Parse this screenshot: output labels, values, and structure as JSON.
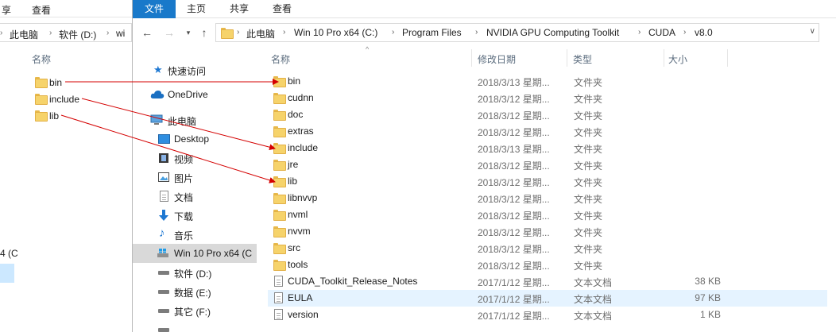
{
  "back_window": {
    "ribbon": {
      "tab1": "享",
      "tab2": "查看"
    },
    "breadcrumb": {
      "c1": "此电脑",
      "c2": "软件 (D:)",
      "c3": "wi"
    },
    "column_name": "名称",
    "items": [
      {
        "name": "bin"
      },
      {
        "name": "include"
      },
      {
        "name": "lib"
      }
    ],
    "side_label": "4 (C"
  },
  "ribbon": {
    "file": "文件",
    "home": "主页",
    "share": "共享",
    "view": "查看"
  },
  "address": {
    "crumbs": [
      "此电脑",
      "Win 10 Pro x64 (C:)",
      "Program Files",
      "NVIDIA GPU Computing Toolkit",
      "CUDA",
      "v8.0"
    ]
  },
  "nav": {
    "quick_access": "快速访问",
    "onedrive": "OneDrive",
    "this_pc": "此电脑",
    "desktop": "Desktop",
    "videos": "视频",
    "pictures": "图片",
    "documents": "文档",
    "downloads": "下载",
    "music": "音乐",
    "drive_c": "Win 10 Pro x64 (C",
    "drive_d": "软件 (D:)",
    "drive_e": "数据 (E:)",
    "drive_f": "其它 (F:)"
  },
  "columns": {
    "name": "名称",
    "modified": "修改日期",
    "type": "类型",
    "size": "大小"
  },
  "files": [
    {
      "name": "bin",
      "date": "2018/3/13 星期...",
      "type": "文件夹",
      "size": "",
      "kind": "folder"
    },
    {
      "name": "cudnn",
      "date": "2018/3/12 星期...",
      "type": "文件夹",
      "size": "",
      "kind": "folder"
    },
    {
      "name": "doc",
      "date": "2018/3/12 星期...",
      "type": "文件夹",
      "size": "",
      "kind": "folder"
    },
    {
      "name": "extras",
      "date": "2018/3/12 星期...",
      "type": "文件夹",
      "size": "",
      "kind": "folder"
    },
    {
      "name": "include",
      "date": "2018/3/13 星期...",
      "type": "文件夹",
      "size": "",
      "kind": "folder"
    },
    {
      "name": "jre",
      "date": "2018/3/12 星期...",
      "type": "文件夹",
      "size": "",
      "kind": "folder"
    },
    {
      "name": "lib",
      "date": "2018/3/12 星期...",
      "type": "文件夹",
      "size": "",
      "kind": "folder"
    },
    {
      "name": "libnvvp",
      "date": "2018/3/12 星期...",
      "type": "文件夹",
      "size": "",
      "kind": "folder"
    },
    {
      "name": "nvml",
      "date": "2018/3/12 星期...",
      "type": "文件夹",
      "size": "",
      "kind": "folder"
    },
    {
      "name": "nvvm",
      "date": "2018/3/12 星期...",
      "type": "文件夹",
      "size": "",
      "kind": "folder"
    },
    {
      "name": "src",
      "date": "2018/3/12 星期...",
      "type": "文件夹",
      "size": "",
      "kind": "folder"
    },
    {
      "name": "tools",
      "date": "2018/3/12 星期...",
      "type": "文件夹",
      "size": "",
      "kind": "folder"
    },
    {
      "name": "CUDA_Toolkit_Release_Notes",
      "date": "2017/1/12 星期...",
      "type": "文本文档",
      "size": "38 KB",
      "kind": "doc"
    },
    {
      "name": "EULA",
      "date": "2017/1/12 星期...",
      "type": "文本文档",
      "size": "97 KB",
      "kind": "doc"
    },
    {
      "name": "version",
      "date": "2017/1/12 星期...",
      "type": "文本文档",
      "size": "1 KB",
      "kind": "doc"
    }
  ],
  "colors": {
    "file_tab": "#1979ca",
    "arrow": "#d40000",
    "selection": "#cce8ff",
    "hover_row": "#e5f3ff"
  }
}
